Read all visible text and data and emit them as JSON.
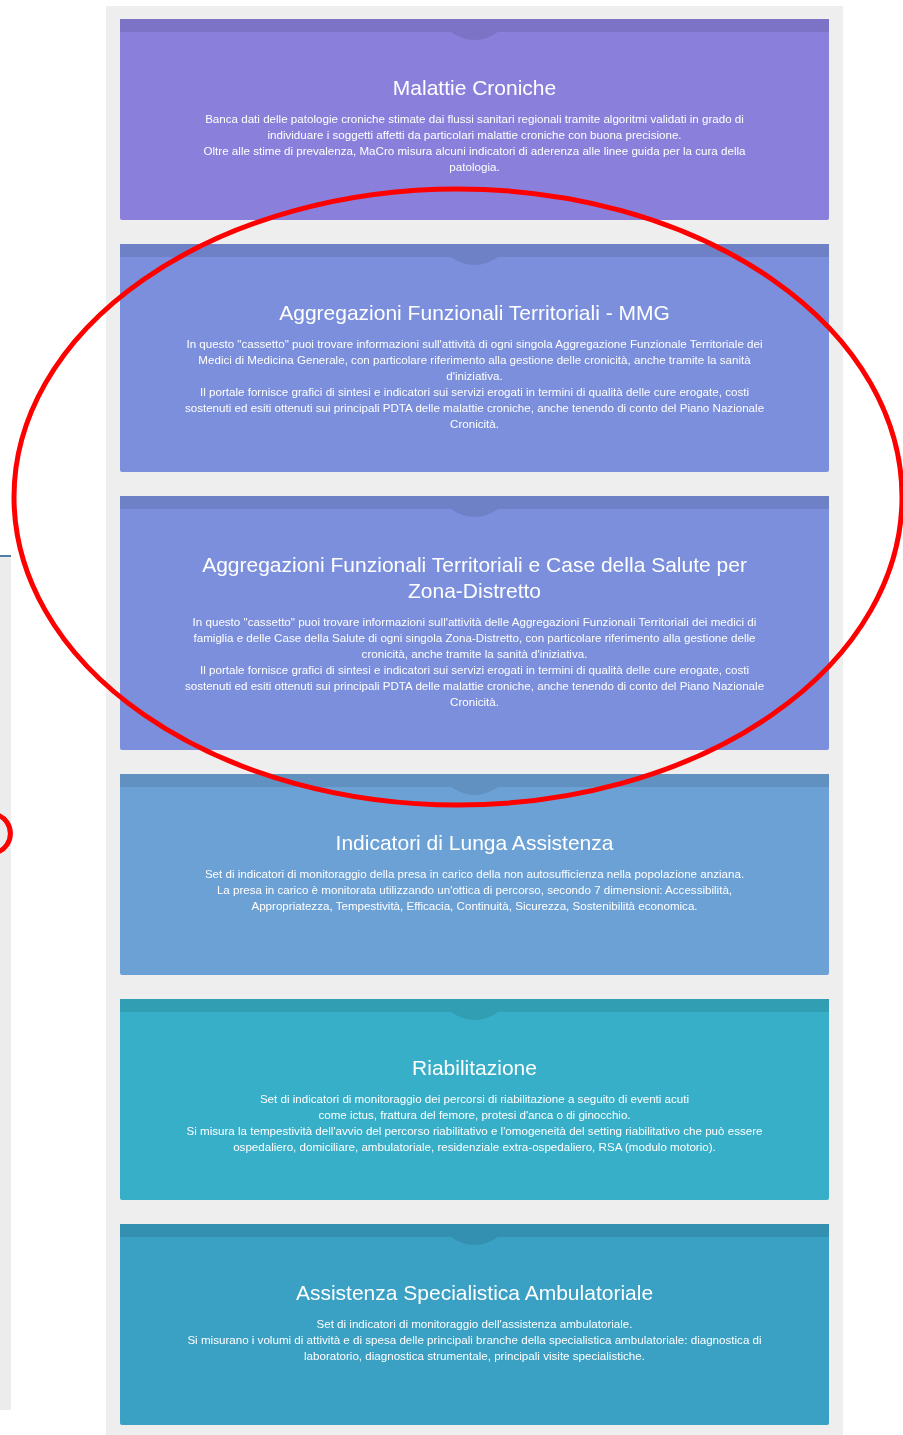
{
  "cards": [
    {
      "title": "Malattie Croniche",
      "color": "#8a80dc",
      "paragraphs": [
        "Banca dati delle patologie croniche stimate dai flussi sanitari regionali tramite algoritmi validati in grado di individuare i soggetti affetti da particolari malattie croniche con buona precisione.",
        "Oltre alle stime di prevalenza, MaCro misura alcuni indicatori di aderenza alle linee guida per la cura della patologia."
      ]
    },
    {
      "title": "Aggregazioni Funzionali Territoriali - MMG",
      "color": "#7b8fdc",
      "paragraphs": [
        "In questo \"cassetto\" puoi trovare informazioni sull'attività di ogni singola Aggregazione Funzionale Territoriale dei Medici di Medicina Generale, con particolare riferimento alla gestione delle cronicità, anche tramite la sanità d'iniziativa.",
        "Il portale fornisce grafici di sintesi e indicatori sui servizi erogati in termini di qualità delle cure erogate, costi sostenuti ed esiti ottenuti sui principali PDTA delle malattie croniche, anche tenendo di conto del Piano Nazionale Cronicità."
      ]
    },
    {
      "title": "Aggregazioni Funzionali Territoriali e Case della Salute per Zona-Distretto",
      "color": "#7b8fdc",
      "paragraphs": [
        "In questo \"cassetto\" puoi trovare informazioni sull'attività delle Aggregazioni Funzionali Territoriali dei medici di famiglia e delle Case della Salute di ogni singola Zona-Distretto, con particolare riferimento alla gestione delle cronicità, anche tramite la sanità d'iniziativa.",
        "Il portale fornisce grafici di sintesi e indicatori sui servizi erogati in termini di qualità delle cure erogate, costi sostenuti ed esiti ottenuti sui principali PDTA delle malattie croniche, anche tenendo di conto del Piano Nazionale Cronicità."
      ]
    },
    {
      "title": "Indicatori di Lunga Assistenza",
      "color": "#6ca1d6",
      "paragraphs": [
        "Set di indicatori di monitoraggio della presa in carico della non autosufficienza nella popolazione anziana.",
        "La presa in carico è monitorata utilizzando un'ottica di percorso, secondo 7 dimensioni: Accessibilità, Appropriatezza, Tempestività, Efficacia, Continuità, Sicurezza, Sostenibilità economica."
      ]
    },
    {
      "title": "Riabilitazione",
      "color": "#38afc8",
      "paragraphs": [
        "Set di indicatori di monitoraggio dei percorsi di riabilitazione a seguito di eventi acuti",
        "come ictus, frattura del femore, protesi d'anca o di ginocchio.",
        "Si misura la tempestività dell'avvio del percorso riabilitativo e l'omogeneità del setting riabilitativo che può essere ospedaliero, domiciliare, ambulatoriale, residenziale extra-ospedaliero, RSA (modulo motorio)."
      ]
    },
    {
      "title": "Assistenza Specialistica Ambulatoriale",
      "color": "#3aa0c4",
      "paragraphs": [
        "Set di indicatori di monitoraggio dell'assistenza ambulatoriale.",
        "Si misurano i volumi di attività e di spesa delle principali branche della specialistica ambulatoriale: diagnostica di laboratorio, diagnostica strumentale, principali visite specialistiche."
      ]
    }
  ]
}
